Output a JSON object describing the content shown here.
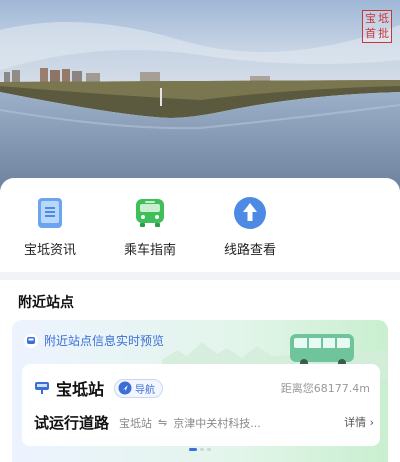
{
  "banner": {
    "alt": "lake-landscape-photo",
    "seal_chars": [
      "宝",
      "坻",
      "首",
      "批"
    ]
  },
  "quick_menu": {
    "items": [
      {
        "label": "宝坻资讯",
        "icon": "news-phone-icon"
      },
      {
        "label": "乘车指南",
        "icon": "bus-icon"
      },
      {
        "label": "线路查看",
        "icon": "route-arrow-icon"
      }
    ]
  },
  "nearby": {
    "title": "附近站点",
    "preview_text": "附近站点信息实时预览",
    "station": {
      "name": "宝坻站",
      "nav_label": "导航",
      "distance": "距离您68177.4m",
      "line_name": "试运行道路",
      "from": "宝坻站",
      "arrows": "⇋",
      "to": "京津中关村科技...",
      "detail": "详情 ›"
    },
    "pager": {
      "count": 3,
      "active": 0
    }
  },
  "colors": {
    "accent": "#3a6fd8",
    "card_green": "#c9efcf",
    "bus_green": "#3fbf5a"
  }
}
